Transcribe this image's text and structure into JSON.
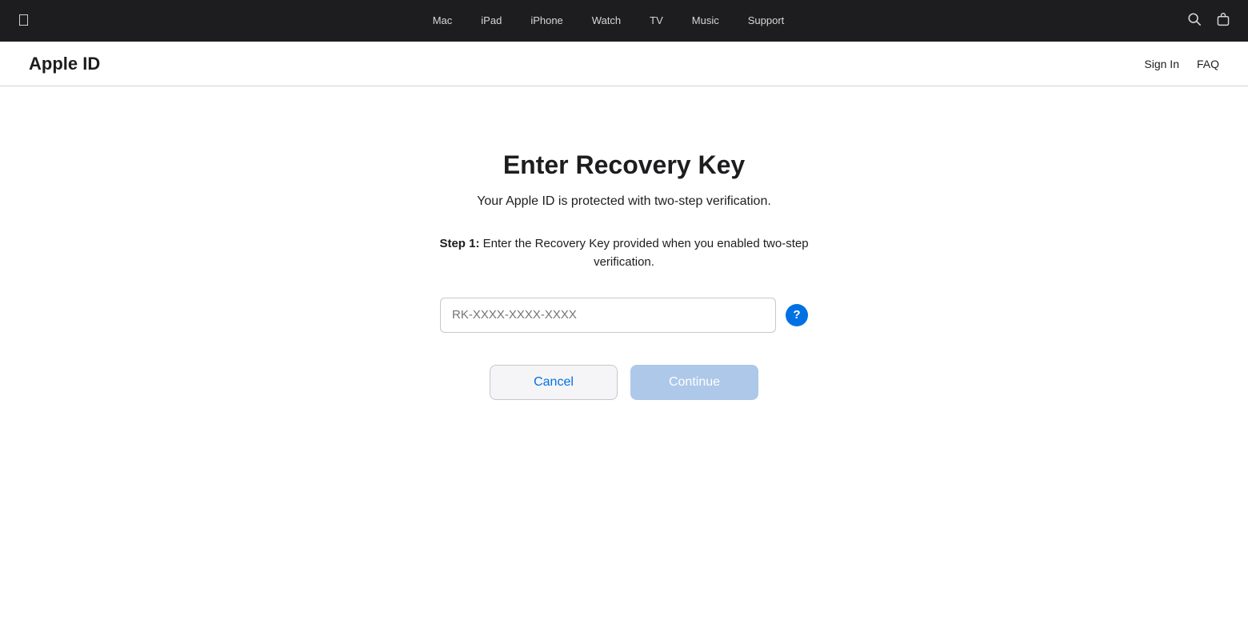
{
  "nav": {
    "apple_logo": "",
    "links": [
      {
        "label": "Mac",
        "id": "mac"
      },
      {
        "label": "iPad",
        "id": "ipad"
      },
      {
        "label": "iPhone",
        "id": "iphone"
      },
      {
        "label": "Watch",
        "id": "watch"
      },
      {
        "label": "TV",
        "id": "tv"
      },
      {
        "label": "Music",
        "id": "music"
      },
      {
        "label": "Support",
        "id": "support"
      }
    ],
    "search_icon": "🔍",
    "bag_icon": "🛍"
  },
  "subnav": {
    "title": "Apple ID",
    "sign_in": "Sign In",
    "faq": "FAQ"
  },
  "main": {
    "page_title": "Enter Recovery Key",
    "subtitle": "Your Apple ID is protected with two-step verification.",
    "step_label": "Step 1:",
    "step_body": " Enter the Recovery Key provided when you enabled two-step verification.",
    "input_placeholder": "RK-XXXX-XXXX-XXXX",
    "cancel_label": "Cancel",
    "continue_label": "Continue",
    "help_icon": "?"
  }
}
